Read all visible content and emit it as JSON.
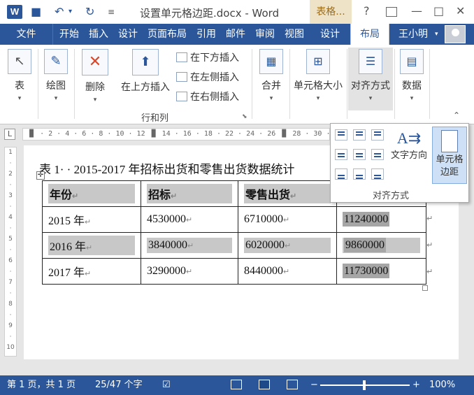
{
  "titlebar": {
    "title": "设置单元格边距.docx - Word",
    "contextual_group": "表格...",
    "help": "?",
    "restore_icon": "ribbon-display-icon",
    "minimize": "—",
    "maximize": "□",
    "close": "✕"
  },
  "tabs": {
    "file": "文件",
    "items": [
      "开始",
      "插入",
      "设计",
      "页面布局",
      "引用",
      "邮件",
      "审阅",
      "视图"
    ],
    "table_design": "设计",
    "table_layout": "布局",
    "user": "王小明"
  },
  "ribbon": {
    "select": "表",
    "draw": "绘图",
    "delete": "删除",
    "insert_above": "在上方插入",
    "insert_below": "在下方插入",
    "insert_left": "在左侧插入",
    "insert_right": "在右侧插入",
    "rows_cols_group": "行和列",
    "merge": "合并",
    "cell_size": "单元格大小",
    "alignment": "对齐方式",
    "data": "数据"
  },
  "dropdown": {
    "text_direction": "文字方向",
    "cell_margins_line1": "单元格",
    "cell_margins_line2": "边距",
    "group_label": "对齐方式"
  },
  "document": {
    "caption": "表 1· · 2015-2017 年招标出货和零售出货数据统计",
    "headers": [
      "年份",
      "招标",
      "零售出货",
      ""
    ],
    "rows": [
      [
        "2015 年",
        "4530000",
        "6710000",
        "11240000"
      ],
      [
        "2016 年",
        "3840000",
        "6020000",
        "9860000"
      ],
      [
        "2017 年",
        "3290000",
        "8440000",
        "11730000"
      ]
    ]
  },
  "statusbar": {
    "page": "第 1 页，共 1 页",
    "words": "25/47 个字",
    "zoom": "100%"
  },
  "colors": {
    "accent": "#2b579a",
    "contextual_tab": "#efe3c7",
    "cell_shade": "#c8c8c8"
  }
}
